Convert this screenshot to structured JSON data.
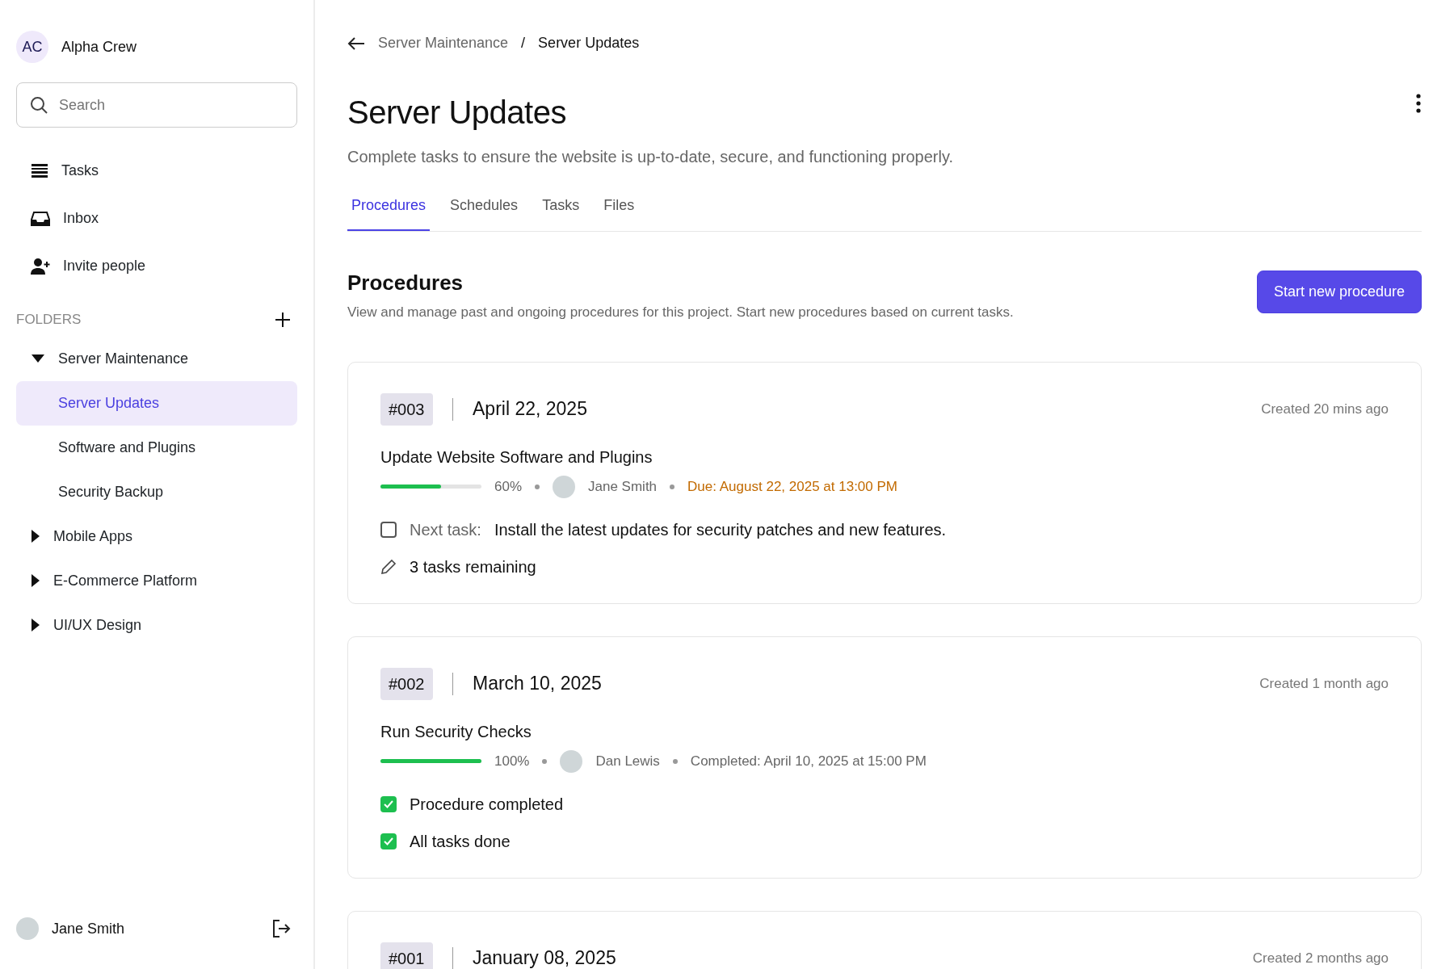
{
  "workspace": {
    "initials": "AC",
    "name": "Alpha Crew"
  },
  "search": {
    "placeholder": "Search"
  },
  "nav": [
    {
      "label": "Tasks"
    },
    {
      "label": "Inbox"
    },
    {
      "label": "Invite people"
    }
  ],
  "folders": {
    "heading": "FOLDERS",
    "items": [
      {
        "label": "Server Maintenance",
        "expanded": true,
        "selected": false,
        "children": [
          {
            "label": "Server Updates",
            "selected": true
          },
          {
            "label": "Software and Plugins",
            "selected": false
          },
          {
            "label": "Security Backup",
            "selected": false
          }
        ]
      },
      {
        "label": "Mobile Apps",
        "expanded": false,
        "selected": false
      },
      {
        "label": "E-Commerce Platform",
        "expanded": false,
        "selected": false
      },
      {
        "label": "UI/UX Design",
        "expanded": false,
        "selected": false
      }
    ]
  },
  "user": {
    "name": "Jane Smith"
  },
  "breadcrumb": [
    "Server Maintenance",
    "Server Updates"
  ],
  "breadcrumb_separator": "/",
  "page": {
    "title": "Server Updates",
    "subtitle": "Complete tasks to ensure the website is up-to-date, secure, and functioning properly."
  },
  "tabs": [
    {
      "label": "Procedures",
      "selected": true
    },
    {
      "label": "Schedules",
      "selected": false
    },
    {
      "label": "Tasks",
      "selected": false
    },
    {
      "label": "Files",
      "selected": false
    }
  ],
  "section": {
    "title": "Procedures",
    "description": "View and manage past and ongoing procedures for this project. Start new procedures based on current tasks.",
    "button": "Start new procedure"
  },
  "procedures": [
    {
      "number": "#003",
      "date": "April 22, 2025",
      "created": "Created 20 mins ago",
      "title": "Update Website Software and Plugins",
      "level": 0.6,
      "percent": "60%",
      "assignee": "Jane Smith",
      "deadline": {
        "kind": "due",
        "text": "Due: August 22, 2025 at 13:00 PM"
      },
      "items": [
        {
          "kind": "task",
          "label": "Next task:",
          "text": "Install the latest updates for security patches and new features.",
          "checked": false
        },
        {
          "kind": "note",
          "text": "3 tasks remaining"
        }
      ]
    },
    {
      "number": "#002",
      "date": "March 10, 2025",
      "created": "Created 1 month ago",
      "title": "Run Security Checks",
      "level": 1,
      "percent": "100%",
      "assignee": "Dan Lewis",
      "deadline": {
        "kind": "completed",
        "text": "Completed: April 10, 2025 at 15:00 PM"
      },
      "items": [
        {
          "kind": "check",
          "text": "Procedure completed",
          "checked": true
        },
        {
          "kind": "check",
          "text": "All tasks done",
          "checked": true
        }
      ]
    },
    {
      "number": "#001",
      "date": "January 08, 2025",
      "created": "Created 2 months ago"
    }
  ]
}
